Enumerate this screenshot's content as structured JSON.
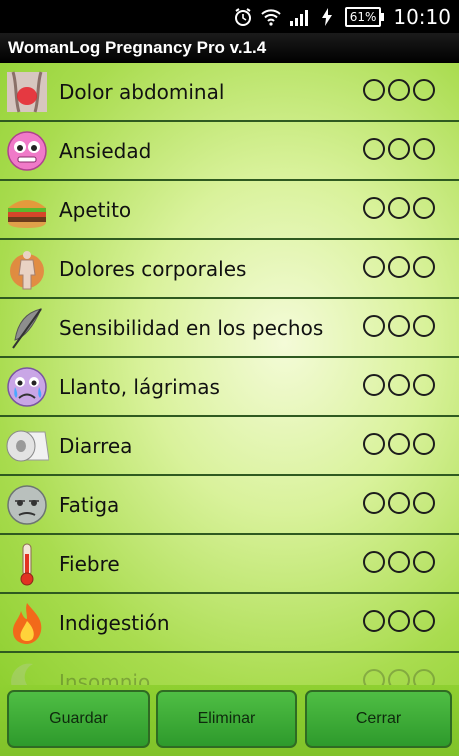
{
  "status_bar": {
    "battery": "61%",
    "time": "10:10"
  },
  "app": {
    "title": "WomanLog Pregnancy Pro v.1.4"
  },
  "symptoms": [
    {
      "label": "Dolor abdominal",
      "icon": "abdomen-icon"
    },
    {
      "label": "Ansiedad",
      "icon": "anxious-face-icon"
    },
    {
      "label": "Apetito",
      "icon": "burger-icon"
    },
    {
      "label": "Dolores corporales",
      "icon": "body-pain-icon"
    },
    {
      "label": "Sensibilidad en los pechos",
      "icon": "feather-icon"
    },
    {
      "label": "Llanto, lágrimas",
      "icon": "crying-face-icon"
    },
    {
      "label": "Diarrea",
      "icon": "toilet-paper-icon"
    },
    {
      "label": "Fatiga",
      "icon": "tired-face-icon"
    },
    {
      "label": "Fiebre",
      "icon": "thermometer-icon"
    },
    {
      "label": "Indigestión",
      "icon": "fire-icon"
    },
    {
      "label": "Insomnio",
      "icon": "moon-icon"
    }
  ],
  "buttons": {
    "save": "Guardar",
    "delete": "Eliminar",
    "close": "Cerrar"
  },
  "colors": {
    "accent_green": "#8fd031",
    "button_green": "#3aa836"
  }
}
